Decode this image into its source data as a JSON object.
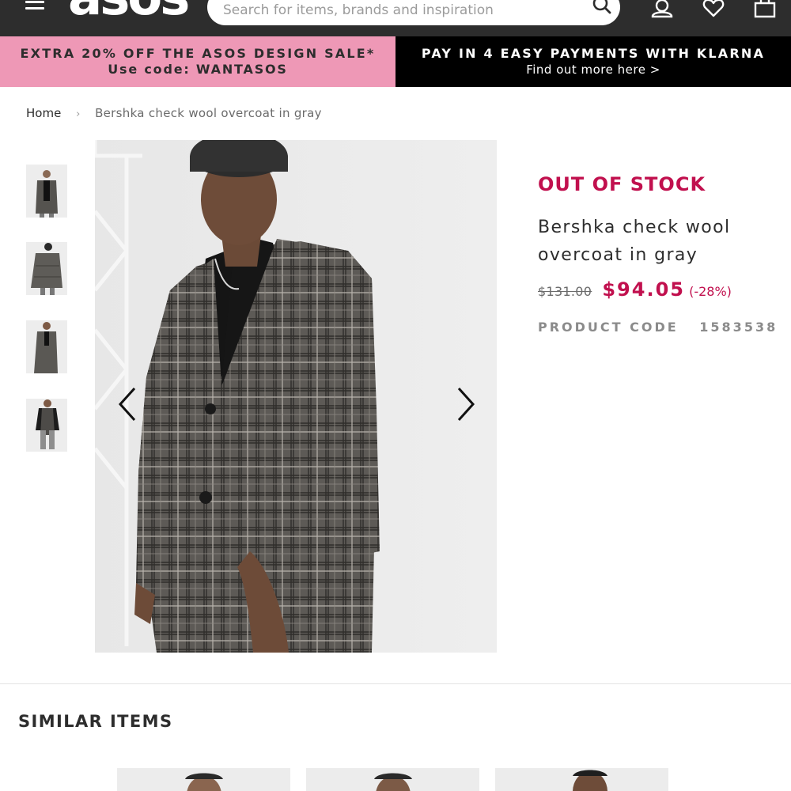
{
  "header": {
    "logo": "asos",
    "search_placeholder": "Search for items, brands and inspiration",
    "icons": [
      "menu-icon",
      "search-icon",
      "account-icon",
      "heart-icon",
      "bag-icon"
    ]
  },
  "promo": {
    "left_line1": "EXTRA 20% OFF THE ASOS DESIGN SALE*",
    "left_line2": "Use code: WANTASOS",
    "right_line1": "PAY IN 4 EASY PAYMENTS WITH KLARNA",
    "right_line2": "Find out more here >",
    "left_bg": "#ee98b6",
    "right_bg": "#000000"
  },
  "breadcrumb": {
    "home": "Home",
    "separator": "›",
    "current": "Bershka check wool overcoat in gray"
  },
  "product": {
    "stock_status": "OUT OF STOCK",
    "name_line1": "Bershka check wool",
    "name_line2": "overcoat in gray",
    "old_price": "$131.00",
    "new_price": "$94.05",
    "discount": "(-28%)",
    "code_label": "PRODUCT CODE",
    "code_value": "1583538",
    "thumbnail_count": 4,
    "accent_color": "#c1104e"
  },
  "similar": {
    "title": "SIMILAR ITEMS",
    "card_count": 3
  }
}
